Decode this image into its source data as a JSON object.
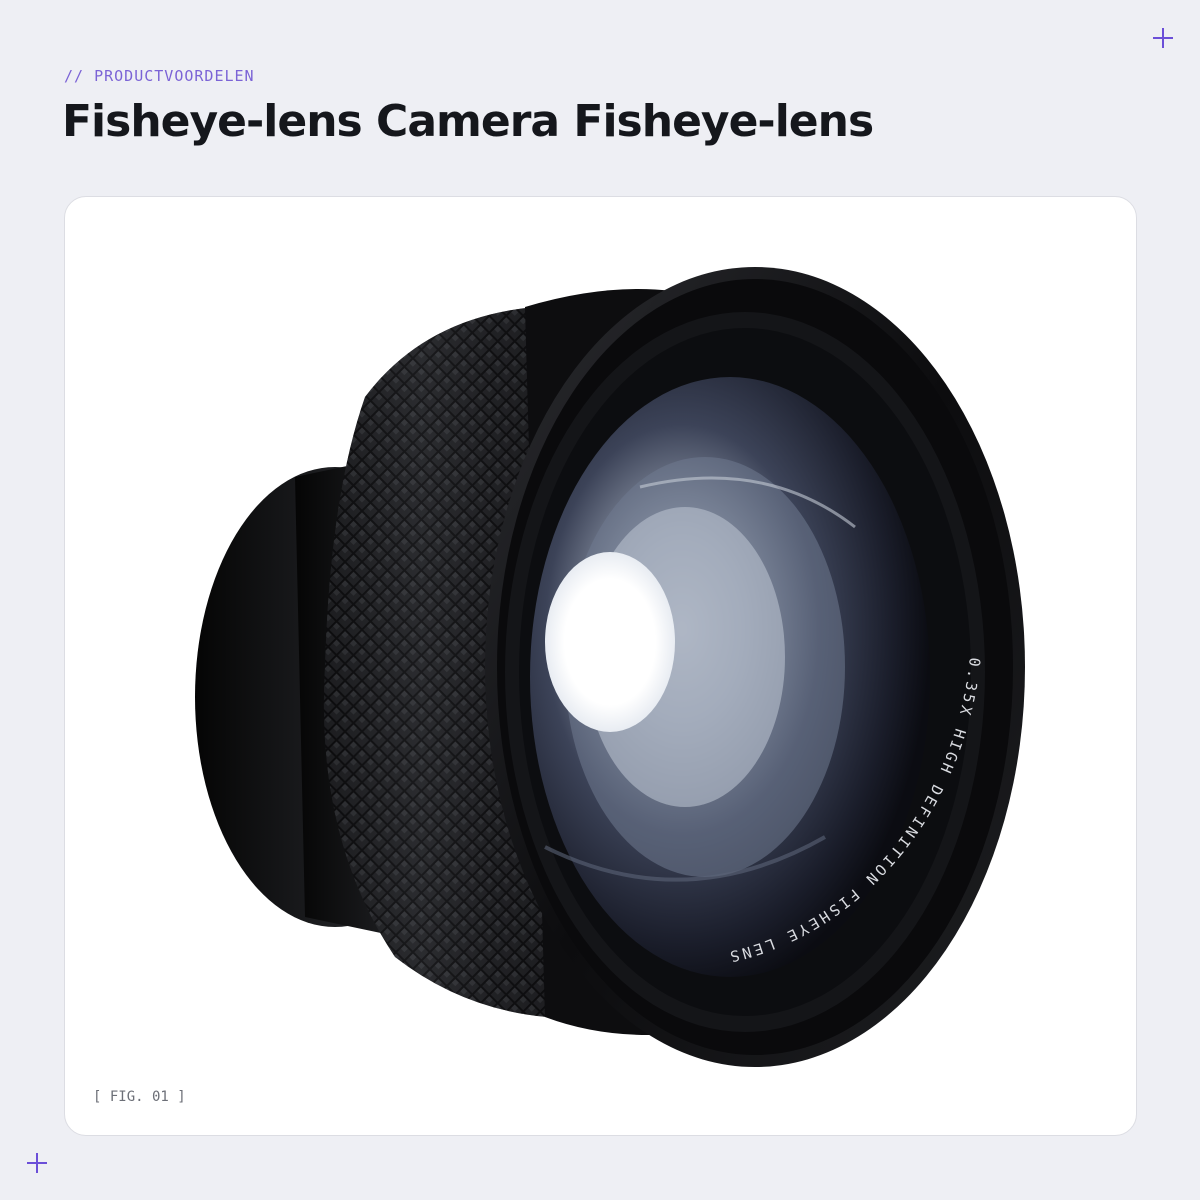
{
  "header": {
    "eyebrow": "// PRODUCTVOORDELEN",
    "title": "Fisheye-lens Camera Fisheye-lens"
  },
  "figure": {
    "caption": "[ FIG. 01 ]",
    "lens_ring_text": "0.35X HIGH DEFINITION FISHEYE LENS",
    "image_subject": "fisheye-lens-photo"
  },
  "decorations": {
    "plus_icon": "plus-icon",
    "accent_color": "#6b4fd8"
  },
  "colors": {
    "page_background": "#eeeff4",
    "card_background": "#ffffff",
    "title_color": "#15171c",
    "eyebrow_color": "#7b63d6"
  }
}
